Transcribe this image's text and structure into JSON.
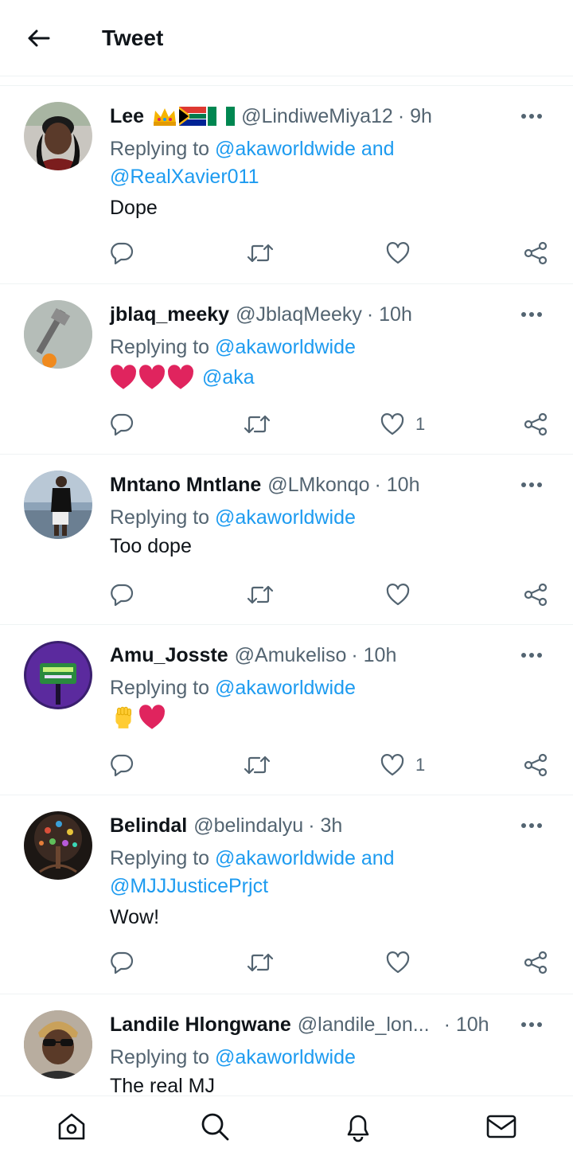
{
  "header": {
    "title": "Tweet"
  },
  "tweets": [
    {
      "name": "Lee",
      "flags": [
        "crown-emoji",
        "south-africa-flag",
        "nigeria-flag"
      ],
      "handle": "@LindiweMiya12",
      "time": "· 9h",
      "replying_prefix": "Replying to",
      "reply_to": [
        "@akaworldwide",
        "@RealXavier011"
      ],
      "reply_joiner": "and",
      "text": "Dope",
      "like_count": ""
    },
    {
      "name": "jblaq_meeky",
      "handle": "@JblaqMeeky",
      "time": "· 10h",
      "replying_prefix": "Replying to",
      "reply_to": [
        "@akaworldwide"
      ],
      "emoji": [
        "red-heart",
        "red-heart",
        "red-heart"
      ],
      "mention": "@aka",
      "like_count": "1"
    },
    {
      "name": "Mntano Mntlane",
      "handle": "@LMkonqo",
      "time": "· 10h",
      "replying_prefix": "Replying to",
      "reply_to": [
        "@akaworldwide"
      ],
      "text": "Too dope",
      "like_count": ""
    },
    {
      "name": "Amu_Josste",
      "handle": "@Amukeliso",
      "time": "· 10h",
      "replying_prefix": "Replying to",
      "reply_to": [
        "@akaworldwide"
      ],
      "emoji": [
        "raised-fist",
        "red-heart"
      ],
      "like_count": "1"
    },
    {
      "name": "Belindal",
      "handle": "@belindalyu",
      "time": "· 3h",
      "replying_prefix": "Replying to",
      "reply_to": [
        "@akaworldwide",
        "@MJJJusticePrjct"
      ],
      "reply_joiner": "and",
      "text": "Wow!",
      "like_count": ""
    },
    {
      "name": "Landile Hlongwane",
      "handle": "@landile_lon...",
      "time": "· 10h",
      "replying_prefix": "Replying to",
      "reply_to": [
        "@akaworldwide"
      ],
      "text": "The real MJ"
    }
  ],
  "icons": {
    "back": "arrow-left-icon",
    "more": "more-horizontal-icon",
    "reply": "comment-icon",
    "retweet": "retweet-icon",
    "like": "heart-icon",
    "share": "share-icon",
    "nav": [
      "home-icon",
      "search-icon",
      "bell-icon",
      "mail-icon"
    ]
  },
  "colors": {
    "link": "#1d9bf0",
    "secondary_text": "#536471",
    "heart": "#e0245e",
    "divider": "#eff3f4"
  }
}
